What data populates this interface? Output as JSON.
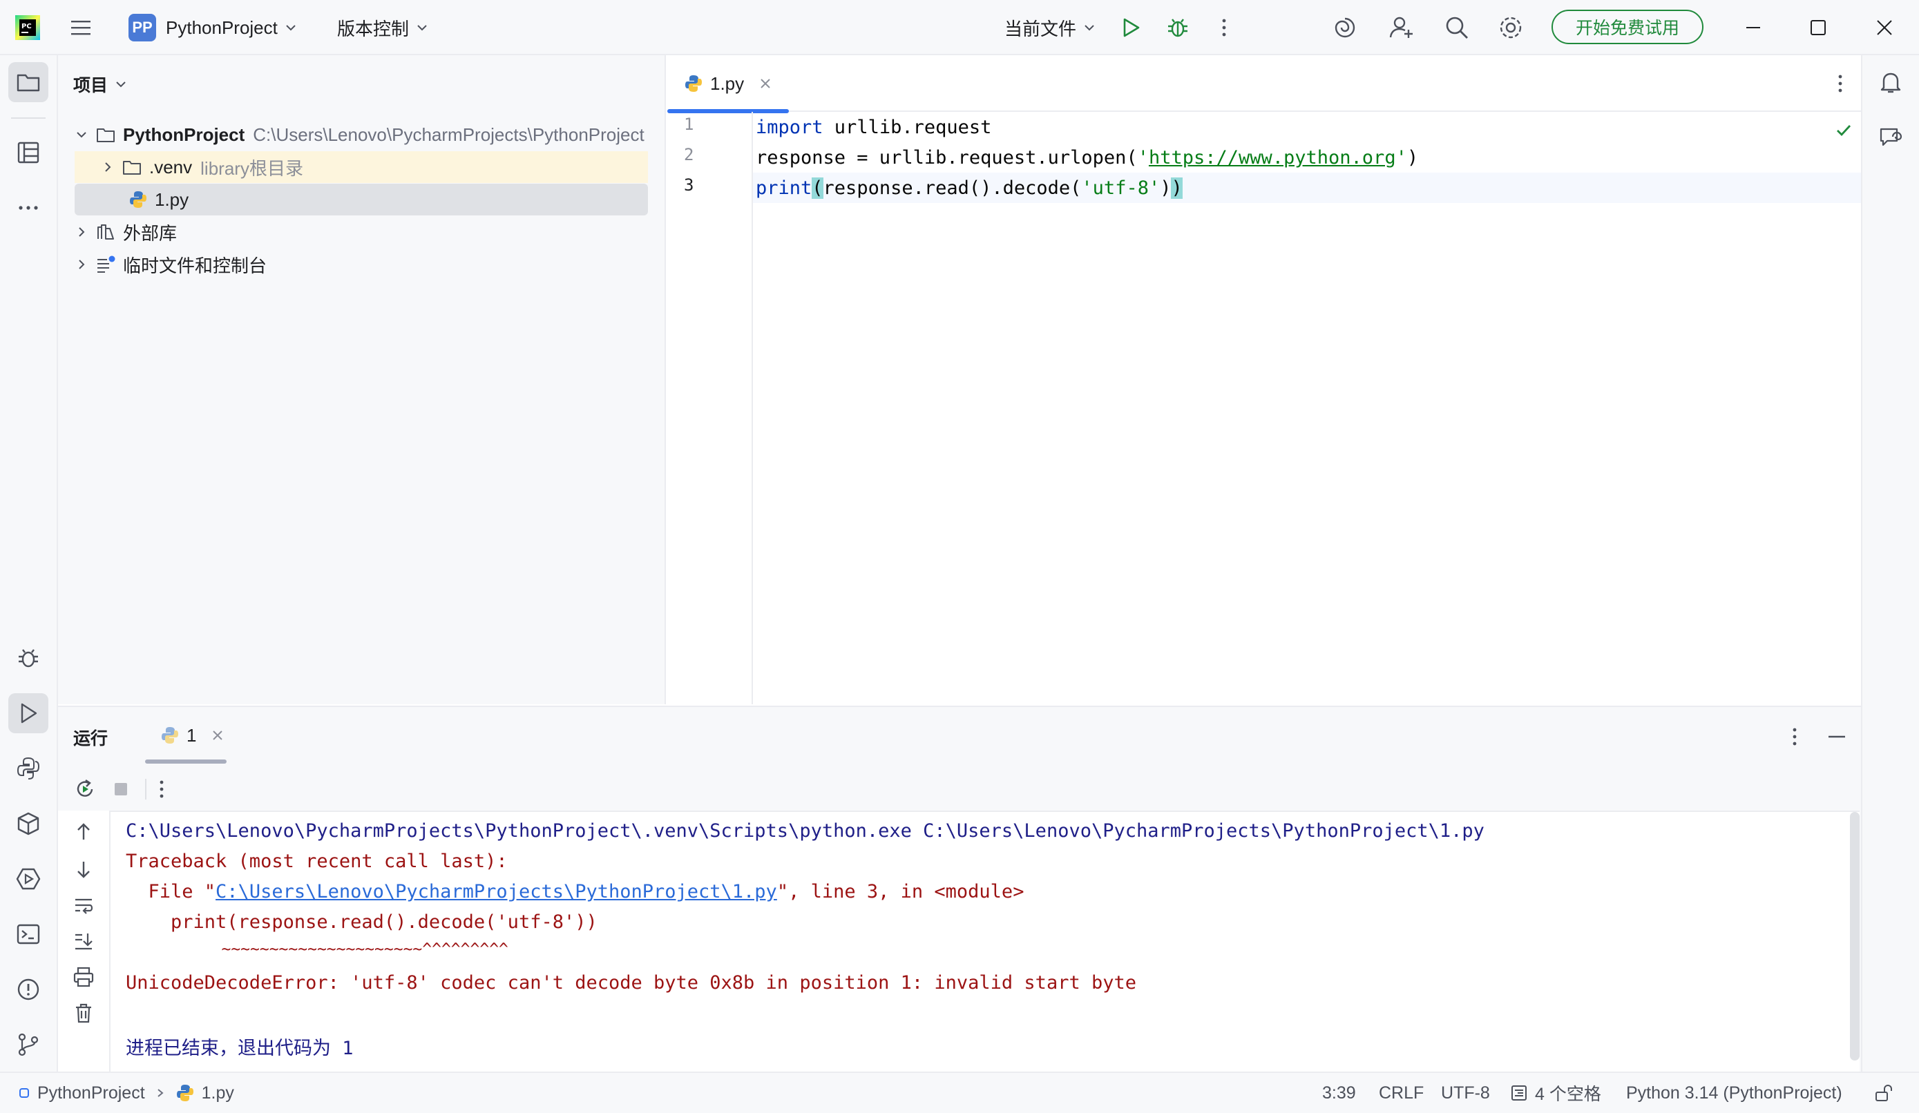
{
  "titlebar": {
    "project_badge": "PP",
    "project_name": "PythonProject",
    "vcs_label": "版本控制",
    "run_config": "当前文件",
    "trial_button": "开始免费试用"
  },
  "project_panel": {
    "title": "项目",
    "tree": {
      "root_name": "PythonProject",
      "root_path": "C:\\Users\\Lenovo\\PycharmProjects\\PythonProject",
      "venv_name": ".venv",
      "venv_note": "library根目录",
      "file_name": "1.py",
      "external_libs": "外部库",
      "scratches": "临时文件和控制台"
    }
  },
  "editor": {
    "tab_label": "1.py",
    "line_numbers": [
      "1",
      "2",
      "3"
    ],
    "code": {
      "l1_kw": "import",
      "l1_rest": " urllib.request",
      "l2_pre": "response = urllib.request.urlopen(",
      "l2_q1": "'",
      "l2_url": "https://www.python.org",
      "l2_q2": "'",
      "l2_post": ")",
      "l3_fn": "print",
      "l3_open": "(",
      "l3_mid": "response.read().decode(",
      "l3_str": "'utf-8'",
      "l3_close1": ")",
      "l3_close2": ")"
    }
  },
  "run_panel": {
    "title": "运行",
    "tab_label": "1",
    "console": {
      "cmd": "C:\\Users\\Lenovo\\PycharmProjects\\PythonProject\\.venv\\Scripts\\python.exe C:\\Users\\Lenovo\\PycharmProjects\\PythonProject\\1.py",
      "traceback": "Traceback (most recent call last):",
      "file_prefix": "  File \"",
      "file_link": "C:\\Users\\Lenovo\\PycharmProjects\\PythonProject\\1.py",
      "file_suffix": "\", line 3, in <module>",
      "code_line": "    print(response.read().decode('utf-8'))",
      "caret_line": "          ~~~~~~~~~~~~~~~~~~~~~^^^^^^^^^",
      "error": "UnicodeDecodeError: 'utf-8' codec can't decode byte 0x8b in position 1: invalid start byte",
      "exit": "进程已结束，退出代码为 1"
    }
  },
  "statusbar": {
    "breadcrumb_project": "PythonProject",
    "breadcrumb_file": "1.py",
    "position": "3:39",
    "line_sep": "CRLF",
    "encoding": "UTF-8",
    "indent": "4 个空格",
    "interpreter": "Python 3.14 (PythonProject)"
  },
  "colors": {
    "accent": "#3574f0",
    "trial_green": "#208a3c",
    "keyword": "#0033b3",
    "string": "#067d17",
    "error_text": "#9c1313"
  }
}
